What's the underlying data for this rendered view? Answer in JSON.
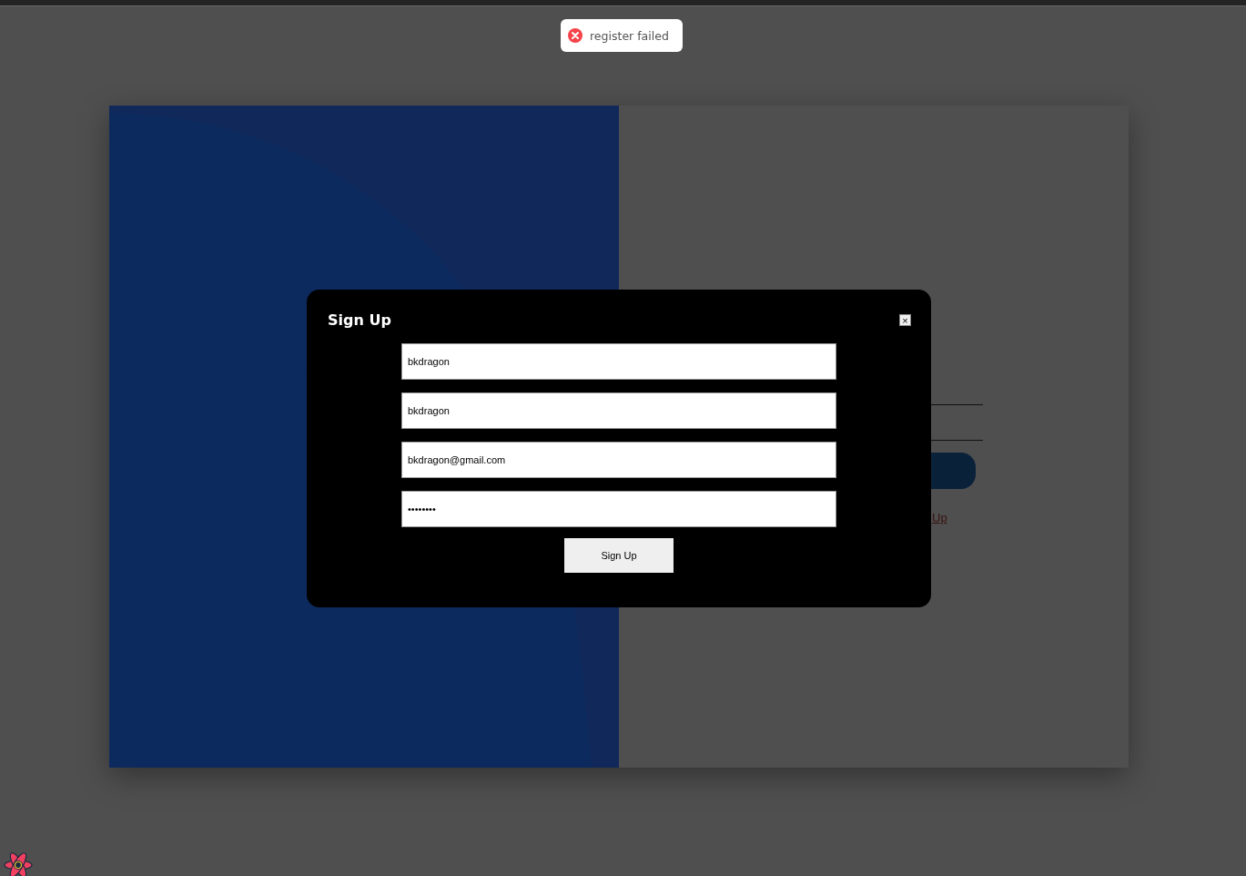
{
  "toast": {
    "kind": "error",
    "message": "register failed"
  },
  "background_form": {
    "fields": [
      {
        "kind": "line"
      },
      {
        "kind": "line"
      }
    ],
    "button": {
      "kind": "filled"
    },
    "link": "Up"
  },
  "modal": {
    "title": "Sign Up",
    "close": "×",
    "fields": [
      {
        "value": "bkdragon"
      },
      {
        "value": "bkdragon"
      },
      {
        "value": "bkdragon@gmail.com"
      },
      {
        "value": "••••••••"
      }
    ],
    "submit": "Sign Up"
  }
}
